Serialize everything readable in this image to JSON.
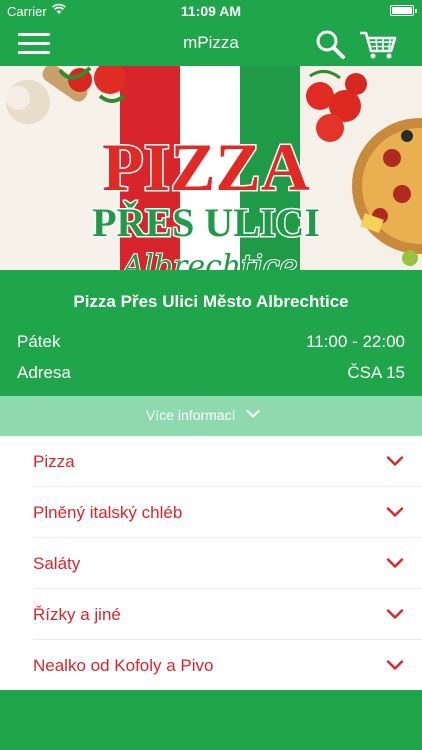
{
  "status_bar": {
    "carrier": "Carrier",
    "time": "11:09 AM"
  },
  "navbar": {
    "title": "mPizza"
  },
  "banner": {
    "logo_line1": "PIZZA",
    "logo_line2": "PŘES ULICI",
    "logo_script": "Albrechtice"
  },
  "restaurant": {
    "name": "Pizza Přes Ulici Město Albrechtice",
    "day_label": "Pátek",
    "hours": "11:00 - 22:00",
    "address_label": "Adresa",
    "address": "ČSA 15"
  },
  "more_info": {
    "label": "Více informací"
  },
  "categories": [
    {
      "label": "Pizza"
    },
    {
      "label": "Plněný italský chléb"
    },
    {
      "label": "Saláty"
    },
    {
      "label": "Řízky a jiné"
    },
    {
      "label": "Nealko od Kofoly a Pivo"
    }
  ],
  "colors": {
    "primary_green": "#1fa64a",
    "light_green": "#8fd9ae",
    "accent_red": "#e0242b"
  }
}
